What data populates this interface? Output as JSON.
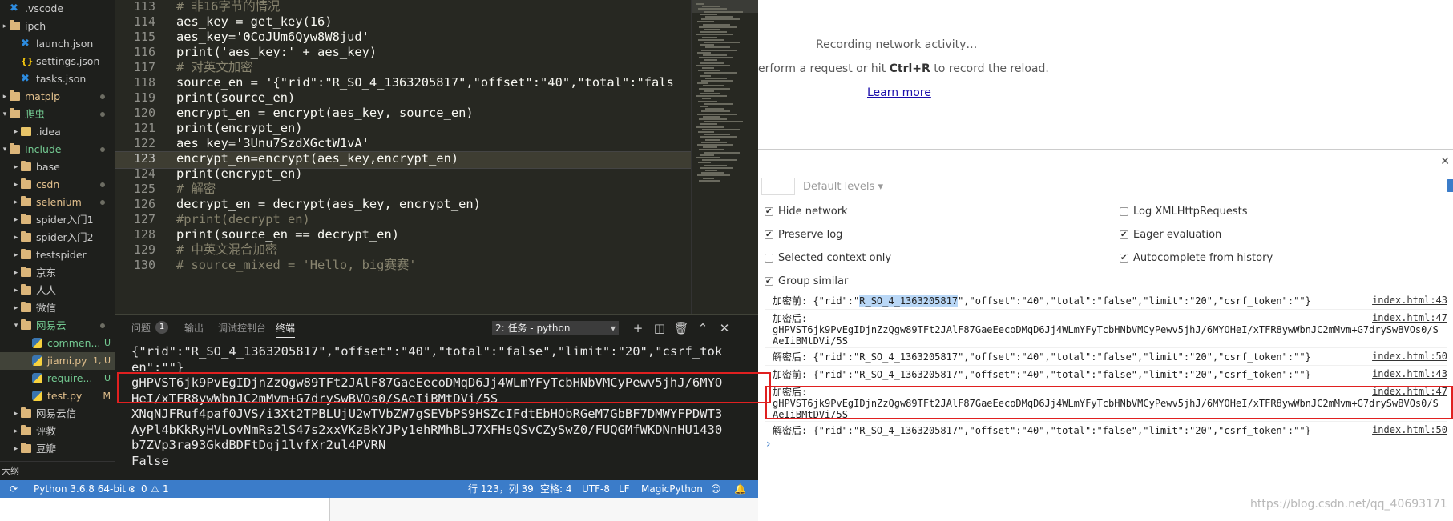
{
  "explorer": {
    "items": [
      {
        "label": ".vscode",
        "color": "#cccccc"
      },
      {
        "label": "ipch",
        "color": "#cccccc"
      },
      {
        "label": "launch.json",
        "color": "#cccccc"
      },
      {
        "label": "settings.json",
        "color": "#cccccc"
      },
      {
        "label": "tasks.json",
        "color": "#cccccc"
      },
      {
        "label": "matplp",
        "color": "#e2c08d"
      },
      {
        "label": "爬虫",
        "color": "#73c991"
      },
      {
        "label": ".idea",
        "color": "#cccccc"
      },
      {
        "label": "Include",
        "color": "#73c991"
      },
      {
        "label": "base",
        "color": "#cccccc"
      },
      {
        "label": "csdn",
        "color": "#e2c08d"
      },
      {
        "label": "selenium",
        "color": "#e2c08d"
      },
      {
        "label": "spider入门1",
        "color": "#cccccc"
      },
      {
        "label": "spider入门2",
        "color": "#cccccc"
      },
      {
        "label": "testspider",
        "color": "#cccccc"
      },
      {
        "label": "京东",
        "color": "#cccccc"
      },
      {
        "label": "人人",
        "color": "#cccccc"
      },
      {
        "label": "微信",
        "color": "#cccccc"
      },
      {
        "label": "网易云",
        "color": "#73c991"
      },
      {
        "label": "commen...",
        "color": "#73c991",
        "badge": "U"
      },
      {
        "label": "jiami.py",
        "color": "#e2c08d",
        "badge": "1, U"
      },
      {
        "label": "require...",
        "color": "#73c991",
        "badge": "U"
      },
      {
        "label": "test.py",
        "color": "#e2c08d",
        "badge": "M"
      },
      {
        "label": "网易云信",
        "color": "#cccccc"
      },
      {
        "label": "评教",
        "color": "#cccccc"
      },
      {
        "label": "豆瓣",
        "color": "#cccccc"
      }
    ],
    "outline_label": "大纲"
  },
  "editor": {
    "current_line": "123",
    "lines": [
      {
        "no": "113",
        "text": "# 非16字节的情况"
      },
      {
        "no": "114",
        "text": "aes_key = get_key(16)"
      },
      {
        "no": "115",
        "text": "aes_key='0CoJUm6Qyw8W8jud'"
      },
      {
        "no": "116",
        "text": "print('aes_key:' + aes_key)"
      },
      {
        "no": "117",
        "text": "# 对英文加密"
      },
      {
        "no": "118",
        "text": "source_en = '{\"rid\":\"R_SO_4_1363205817\",\"offset\":\"40\",\"total\":\"fals"
      },
      {
        "no": "119",
        "text": "print(source_en)"
      },
      {
        "no": "120",
        "text": "encrypt_en = encrypt(aes_key, source_en)"
      },
      {
        "no": "121",
        "text": "print(encrypt_en)"
      },
      {
        "no": "122",
        "text": "aes_key='3Unu7SzdXGctW1vA'"
      },
      {
        "no": "123",
        "text": "encrypt_en=encrypt(aes_key,encrypt_en)"
      },
      {
        "no": "124",
        "text": "print(encrypt_en)"
      },
      {
        "no": "125",
        "text": "# 解密"
      },
      {
        "no": "126",
        "text": "decrypt_en = decrypt(aes_key, encrypt_en)"
      },
      {
        "no": "127",
        "text": "#print(decrypt_en)"
      },
      {
        "no": "128",
        "text": "print(source_en == decrypt_en)"
      },
      {
        "no": "129",
        "text": "# 中英文混合加密"
      },
      {
        "no": "130",
        "text": "# source_mixed = 'Hello, big赛赛'"
      }
    ]
  },
  "panel": {
    "tabs": {
      "problems": "问题",
      "problems_count": "1",
      "output": "输出",
      "debug_console": "调试控制台",
      "terminal": "终端"
    },
    "task_select": "2: 任务 - python",
    "terminal_lines": [
      "{\"rid\":\"R_SO_4_1363205817\",\"offset\":\"40\",\"total\":\"false\",\"limit\":\"20\",\"csrf_tok",
      "en\":\"\"}",
      "gHPVST6jk9PvEgIDjnZzQgw89TFt2JAlF87GaeEecoDMqD6Jj4WLmYFyTcbHNbVMCyPewv5jhJ/6MYO",
      "HeI/xTFR8ywWbnJC2mMvm+G7drySwBVOs0/SAeIiBMtDVi/5S",
      "XNqNJFRuf4paf0JVS/i3Xt2TPBLUjU2wTVbZW7gSEVbPS9HSZcIFdtEbHObRGeM7GbBF7DMWYFPDWT3",
      "AyPl4bKkRyHVLovNmRs2lS47s2xxVKzBkYJPy1ehRMhBLJ7XFHsQSvCZySwZ0/FUQGMfWKDNnHU1430",
      "b7ZVp3ra93GkdBDFtDqj1lvfXr2ul4PVRN",
      "False"
    ]
  },
  "statusbar": {
    "python": "Python 3.6.8 64-bit",
    "errors": "0",
    "warnings": "1",
    "position": "行 123，列 39",
    "spaces": "空格: 4",
    "encoding": "UTF-8",
    "eol": "LF",
    "language": "MagicPython"
  },
  "devtools": {
    "network": {
      "recording": "Recording network activity…",
      "instruction_prefix": "erform a request or hit",
      "instruction_key": "Ctrl+R",
      "instruction_suffix": "to record the reload.",
      "learn_more": "Learn more"
    },
    "console": {
      "levels": "Default levels",
      "settings": [
        {
          "label": "Hide network",
          "checked": true
        },
        {
          "label": "Log XMLHttpRequests",
          "checked": false
        },
        {
          "label": "Preserve log",
          "checked": true
        },
        {
          "label": "Eager evaluation",
          "checked": true
        },
        {
          "label": "Selected context only",
          "checked": false
        },
        {
          "label": "Autocomplete from history",
          "checked": true
        },
        {
          "label": "Group similar",
          "checked": true
        }
      ],
      "messages": [
        {
          "prefix": "加密前: {\"rid\":\"",
          "highlight": "R_SO_4_1363205817",
          "rest": "\",\"offset\":\"40\",\"total\":\"false\",\"limit\":\"20\",\"csrf_token\":\"\"}",
          "source": "index.html:43"
        },
        {
          "prefix": "加密后:\ngHPVST6jk9PvEgIDjnZzQgw89TFt2JAlF87GaeEecoDMqD6Jj4WLmYFyTcbHNbVMCyPewv5jhJ/6MYOHeI/xTFR8ywWbnJC2mMvm+G7drySwBVOs0/S\nAeIiBMtDVi/5S",
          "highlight": "",
          "rest": "",
          "source": "index.html:47"
        },
        {
          "prefix": "解密后: {\"rid\":\"R_SO_4_1363205817\",\"offset\":\"40\",\"total\":\"false\",\"limit\":\"20\",\"csrf_token\":\"\"}",
          "highlight": "",
          "rest": "",
          "source": "index.html:50"
        },
        {
          "prefix": "加密前: {\"rid\":\"R_SO_4_1363205817\",\"offset\":\"40\",\"total\":\"false\",\"limit\":\"20\",\"csrf_token\":\"\"}",
          "highlight": "",
          "rest": "",
          "source": "index.html:43"
        },
        {
          "prefix": "加密后:\ngHPVST6jk9PvEgIDjnZzQgw89TFt2JAlF87GaeEecoDMqD6Jj4WLmYFyTcbHNbVMCyPewv5jhJ/6MYOHeI/xTFR8ywWbnJC2mMvm+G7drySwBVOs0/S\nAeIiBMtDVi/5S",
          "highlight": "",
          "rest": "",
          "source": "index.html:47"
        },
        {
          "prefix": "解密后: {\"rid\":\"R_SO_4_1363205817\",\"offset\":\"40\",\"total\":\"false\",\"limit\":\"20\",\"csrf_token\":\"\"}",
          "highlight": "",
          "rest": "",
          "source": "index.html:50"
        }
      ],
      "prompt": "›"
    }
  },
  "watermark": "https://blog.csdn.net/qq_40693171"
}
